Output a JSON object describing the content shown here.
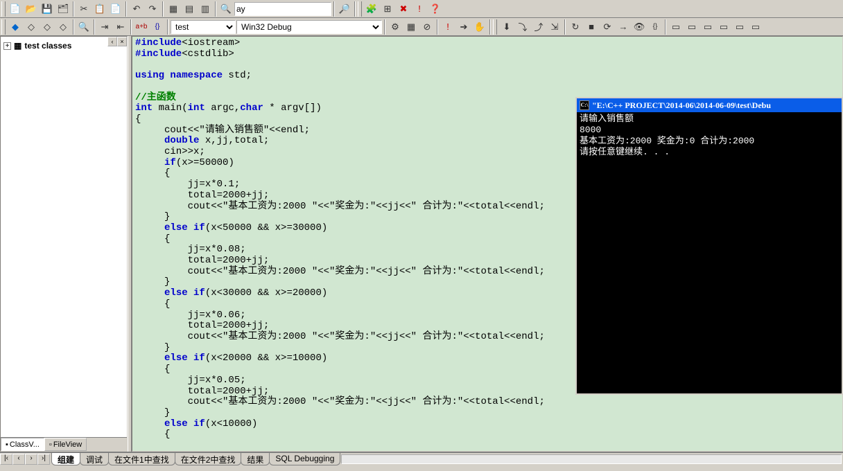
{
  "toolbars": {
    "row1_find_value": "ay",
    "row2": {
      "replace_label": "a+b",
      "combo1_selected": "test",
      "combo2_selected": "Win32 Debug"
    }
  },
  "sidebar": {
    "tree_root": "test classes",
    "tabs": [
      {
        "label": "ClassV...",
        "icon": "class-icon"
      },
      {
        "label": "FileView",
        "icon": "file-icon"
      }
    ],
    "active_tab": 0
  },
  "code_lines": [
    [
      [
        "kw",
        "#include"
      ],
      [
        "",
        "<iostream>"
      ]
    ],
    [
      [
        "kw",
        "#include"
      ],
      [
        "",
        "<cstdlib>"
      ]
    ],
    [
      [
        "",
        ""
      ]
    ],
    [
      [
        "kw",
        "using namespace"
      ],
      [
        "",
        " std;"
      ]
    ],
    [
      [
        "",
        ""
      ]
    ],
    [
      [
        "cm",
        "//主函数"
      ]
    ],
    [
      [
        "kw",
        "int"
      ],
      [
        "",
        " main("
      ],
      [
        "kw",
        "int"
      ],
      [
        "",
        " argc,"
      ],
      [
        "kw",
        "char"
      ],
      [
        "",
        " * argv[])"
      ]
    ],
    [
      [
        "",
        "{"
      ]
    ],
    [
      [
        "",
        "     cout<<\"请输入销售额\"<<endl;"
      ]
    ],
    [
      [
        "",
        "     "
      ],
      [
        "kw",
        "double"
      ],
      [
        "",
        " x,jj,total;"
      ]
    ],
    [
      [
        "",
        "     cin>>x;"
      ]
    ],
    [
      [
        "",
        "     "
      ],
      [
        "kw",
        "if"
      ],
      [
        "",
        "(x>=50000)"
      ]
    ],
    [
      [
        "",
        "     {"
      ]
    ],
    [
      [
        "",
        "         jj=x*0.1;"
      ]
    ],
    [
      [
        "",
        "         total=2000+jj;"
      ]
    ],
    [
      [
        "",
        "         cout<<\"基本工资为:2000 \"<<\"奖金为:\"<<jj<<\" 合计为:\"<<total<<endl;"
      ]
    ],
    [
      [
        "",
        "     }"
      ]
    ],
    [
      [
        "",
        "     "
      ],
      [
        "kw",
        "else if"
      ],
      [
        "",
        "(x<50000 && x>=30000)"
      ]
    ],
    [
      [
        "",
        "     {"
      ]
    ],
    [
      [
        "",
        "         jj=x*0.08;"
      ]
    ],
    [
      [
        "",
        "         total=2000+jj;"
      ]
    ],
    [
      [
        "",
        "         cout<<\"基本工资为:2000 \"<<\"奖金为:\"<<jj<<\" 合计为:\"<<total<<endl;"
      ]
    ],
    [
      [
        "",
        "     }"
      ]
    ],
    [
      [
        "",
        "     "
      ],
      [
        "kw",
        "else if"
      ],
      [
        "",
        "(x<30000 && x>=20000)"
      ]
    ],
    [
      [
        "",
        "     {"
      ]
    ],
    [
      [
        "",
        "         jj=x*0.06;"
      ]
    ],
    [
      [
        "",
        "         total=2000+jj;"
      ]
    ],
    [
      [
        "",
        "         cout<<\"基本工资为:2000 \"<<\"奖金为:\"<<jj<<\" 合计为:\"<<total<<endl;"
      ]
    ],
    [
      [
        "",
        "     }"
      ]
    ],
    [
      [
        "",
        "     "
      ],
      [
        "kw",
        "else if"
      ],
      [
        "",
        "(x<20000 && x>=10000)"
      ]
    ],
    [
      [
        "",
        "     {"
      ]
    ],
    [
      [
        "",
        "         jj=x*0.05;"
      ]
    ],
    [
      [
        "",
        "         total=2000+jj;"
      ]
    ],
    [
      [
        "",
        "         cout<<\"基本工资为:2000 \"<<\"奖金为:\"<<jj<<\" 合计为:\"<<total<<endl;"
      ]
    ],
    [
      [
        "",
        "     }"
      ]
    ],
    [
      [
        "",
        "     "
      ],
      [
        "kw",
        "else if"
      ],
      [
        "",
        "(x<10000)"
      ]
    ],
    [
      [
        "",
        "     {"
      ]
    ]
  ],
  "console": {
    "title": "\"E:\\C++ PROJECT\\2014-06\\2014-06-09\\test\\Debu",
    "lines": [
      "请输入销售额",
      "8000",
      "基本工资为:2000 奖金为:0 合计为:2000",
      "请按任意键继续. . ."
    ]
  },
  "output_tabs": {
    "items": [
      "组建",
      "调试",
      "在文件1中查找",
      "在文件2中查找",
      "结果",
      "SQL Debugging"
    ],
    "active": 0
  }
}
